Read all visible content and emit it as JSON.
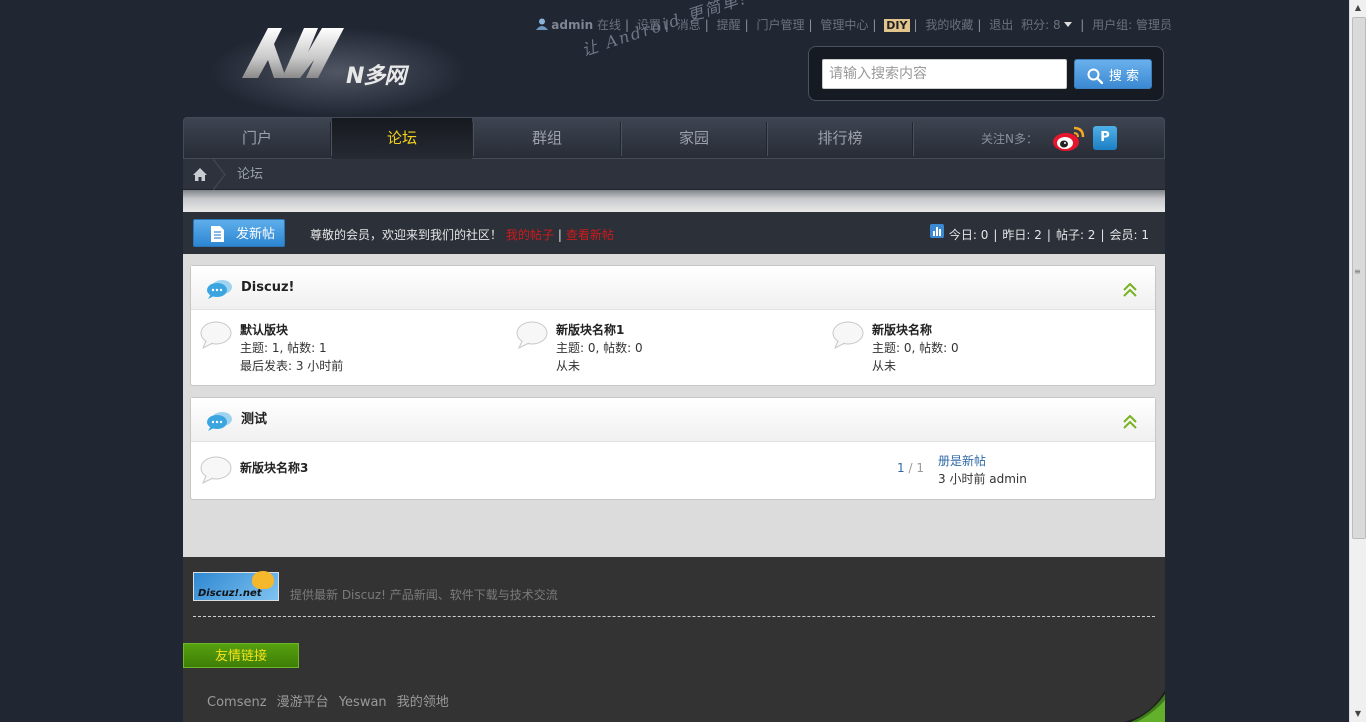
{
  "header": {
    "logo_text": "N多网",
    "slogan": "让 Android 更简单!",
    "topbar": {
      "username": "admin",
      "status": "在线",
      "links": [
        "设置",
        "消息",
        "提醒",
        "门户管理",
        "管理中心"
      ],
      "diy": "DIY",
      "favorites": "我的收藏",
      "logout": "退出",
      "points": "积分: 8",
      "usergroup": "用户组: 管理员"
    },
    "search": {
      "placeholder": "请输入搜索内容",
      "button": "搜 索"
    }
  },
  "nav": {
    "items": [
      "门户",
      "论坛",
      "群组",
      "家园",
      "排行榜"
    ],
    "active": "论坛",
    "follow_label": "关注N多："
  },
  "breadcrumb": {
    "current": "论坛"
  },
  "actionbar": {
    "new_post": "发新帖",
    "welcome": "尊敬的会员，欢迎来到我们的社区！",
    "my_posts": "我的帖子",
    "view_new": "查看新帖",
    "stats": {
      "today": "今日: 0",
      "yesterday": "昨日: 2",
      "posts": "帖子: 2",
      "members": "会员: 1"
    }
  },
  "categories": [
    {
      "title": "Discuz!",
      "forums": [
        {
          "name": "默认版块",
          "line1": "主题: 1, 帖数: 1",
          "line2": "最后发表: 3 小时前"
        },
        {
          "name": "新版块名称1",
          "line1": "主题: 0, 帖数: 0",
          "line2": "从未"
        },
        {
          "name": "新版块名称",
          "line1": "主题: 0, 帖数: 0",
          "line2": "从未"
        }
      ]
    },
    {
      "title": "测试",
      "forums": [
        {
          "name": "新版块名称3",
          "count_num": "1",
          "count_total": " / 1",
          "last_title": "册是新帖",
          "last_info": "3 小时前 admin"
        }
      ]
    }
  ],
  "footer": {
    "logo_text": "Discuz!.net",
    "description": "提供最新 Discuz! 产品新闻、软件下载与技术交流",
    "friend_links_label": "友情链接",
    "links": [
      "Comsenz",
      "漫游平台",
      "Yeswan",
      "我的领地"
    ]
  },
  "colors": {
    "accent_yellow": "#f4d11c",
    "link_red": "#d21a1a",
    "link_blue": "#2f6aa8",
    "button_blue": "#3b89d3",
    "friend_green": "#57a00f"
  },
  "icons": [
    "user-icon",
    "dropdown-arrow-icon",
    "search-icon",
    "weibo-icon",
    "tencent-weibo-icon",
    "home-icon",
    "document-icon",
    "stats-chart-icon",
    "speech-bubble-icon",
    "collapse-icon",
    "forum-bubble-icon"
  ]
}
